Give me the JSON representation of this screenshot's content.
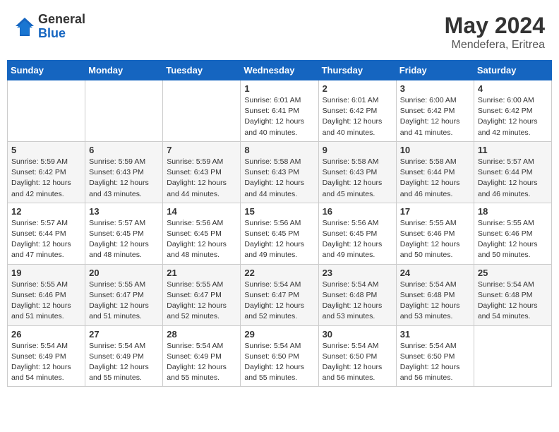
{
  "header": {
    "logo_general": "General",
    "logo_blue": "Blue",
    "month_year": "May 2024",
    "location": "Mendefera, Eritrea"
  },
  "weekdays": [
    "Sunday",
    "Monday",
    "Tuesday",
    "Wednesday",
    "Thursday",
    "Friday",
    "Saturday"
  ],
  "weeks": [
    [
      {
        "day": "",
        "sunrise": "",
        "sunset": "",
        "daylight": ""
      },
      {
        "day": "",
        "sunrise": "",
        "sunset": "",
        "daylight": ""
      },
      {
        "day": "",
        "sunrise": "",
        "sunset": "",
        "daylight": ""
      },
      {
        "day": "1",
        "sunrise": "Sunrise: 6:01 AM",
        "sunset": "Sunset: 6:41 PM",
        "daylight": "Daylight: 12 hours and 40 minutes."
      },
      {
        "day": "2",
        "sunrise": "Sunrise: 6:01 AM",
        "sunset": "Sunset: 6:42 PM",
        "daylight": "Daylight: 12 hours and 40 minutes."
      },
      {
        "day": "3",
        "sunrise": "Sunrise: 6:00 AM",
        "sunset": "Sunset: 6:42 PM",
        "daylight": "Daylight: 12 hours and 41 minutes."
      },
      {
        "day": "4",
        "sunrise": "Sunrise: 6:00 AM",
        "sunset": "Sunset: 6:42 PM",
        "daylight": "Daylight: 12 hours and 42 minutes."
      }
    ],
    [
      {
        "day": "5",
        "sunrise": "Sunrise: 5:59 AM",
        "sunset": "Sunset: 6:42 PM",
        "daylight": "Daylight: 12 hours and 42 minutes."
      },
      {
        "day": "6",
        "sunrise": "Sunrise: 5:59 AM",
        "sunset": "Sunset: 6:43 PM",
        "daylight": "Daylight: 12 hours and 43 minutes."
      },
      {
        "day": "7",
        "sunrise": "Sunrise: 5:59 AM",
        "sunset": "Sunset: 6:43 PM",
        "daylight": "Daylight: 12 hours and 44 minutes."
      },
      {
        "day": "8",
        "sunrise": "Sunrise: 5:58 AM",
        "sunset": "Sunset: 6:43 PM",
        "daylight": "Daylight: 12 hours and 44 minutes."
      },
      {
        "day": "9",
        "sunrise": "Sunrise: 5:58 AM",
        "sunset": "Sunset: 6:43 PM",
        "daylight": "Daylight: 12 hours and 45 minutes."
      },
      {
        "day": "10",
        "sunrise": "Sunrise: 5:58 AM",
        "sunset": "Sunset: 6:44 PM",
        "daylight": "Daylight: 12 hours and 46 minutes."
      },
      {
        "day": "11",
        "sunrise": "Sunrise: 5:57 AM",
        "sunset": "Sunset: 6:44 PM",
        "daylight": "Daylight: 12 hours and 46 minutes."
      }
    ],
    [
      {
        "day": "12",
        "sunrise": "Sunrise: 5:57 AM",
        "sunset": "Sunset: 6:44 PM",
        "daylight": "Daylight: 12 hours and 47 minutes."
      },
      {
        "day": "13",
        "sunrise": "Sunrise: 5:57 AM",
        "sunset": "Sunset: 6:45 PM",
        "daylight": "Daylight: 12 hours and 48 minutes."
      },
      {
        "day": "14",
        "sunrise": "Sunrise: 5:56 AM",
        "sunset": "Sunset: 6:45 PM",
        "daylight": "Daylight: 12 hours and 48 minutes."
      },
      {
        "day": "15",
        "sunrise": "Sunrise: 5:56 AM",
        "sunset": "Sunset: 6:45 PM",
        "daylight": "Daylight: 12 hours and 49 minutes."
      },
      {
        "day": "16",
        "sunrise": "Sunrise: 5:56 AM",
        "sunset": "Sunset: 6:45 PM",
        "daylight": "Daylight: 12 hours and 49 minutes."
      },
      {
        "day": "17",
        "sunrise": "Sunrise: 5:55 AM",
        "sunset": "Sunset: 6:46 PM",
        "daylight": "Daylight: 12 hours and 50 minutes."
      },
      {
        "day": "18",
        "sunrise": "Sunrise: 5:55 AM",
        "sunset": "Sunset: 6:46 PM",
        "daylight": "Daylight: 12 hours and 50 minutes."
      }
    ],
    [
      {
        "day": "19",
        "sunrise": "Sunrise: 5:55 AM",
        "sunset": "Sunset: 6:46 PM",
        "daylight": "Daylight: 12 hours and 51 minutes."
      },
      {
        "day": "20",
        "sunrise": "Sunrise: 5:55 AM",
        "sunset": "Sunset: 6:47 PM",
        "daylight": "Daylight: 12 hours and 51 minutes."
      },
      {
        "day": "21",
        "sunrise": "Sunrise: 5:55 AM",
        "sunset": "Sunset: 6:47 PM",
        "daylight": "Daylight: 12 hours and 52 minutes."
      },
      {
        "day": "22",
        "sunrise": "Sunrise: 5:54 AM",
        "sunset": "Sunset: 6:47 PM",
        "daylight": "Daylight: 12 hours and 52 minutes."
      },
      {
        "day": "23",
        "sunrise": "Sunrise: 5:54 AM",
        "sunset": "Sunset: 6:48 PM",
        "daylight": "Daylight: 12 hours and 53 minutes."
      },
      {
        "day": "24",
        "sunrise": "Sunrise: 5:54 AM",
        "sunset": "Sunset: 6:48 PM",
        "daylight": "Daylight: 12 hours and 53 minutes."
      },
      {
        "day": "25",
        "sunrise": "Sunrise: 5:54 AM",
        "sunset": "Sunset: 6:48 PM",
        "daylight": "Daylight: 12 hours and 54 minutes."
      }
    ],
    [
      {
        "day": "26",
        "sunrise": "Sunrise: 5:54 AM",
        "sunset": "Sunset: 6:49 PM",
        "daylight": "Daylight: 12 hours and 54 minutes."
      },
      {
        "day": "27",
        "sunrise": "Sunrise: 5:54 AM",
        "sunset": "Sunset: 6:49 PM",
        "daylight": "Daylight: 12 hours and 55 minutes."
      },
      {
        "day": "28",
        "sunrise": "Sunrise: 5:54 AM",
        "sunset": "Sunset: 6:49 PM",
        "daylight": "Daylight: 12 hours and 55 minutes."
      },
      {
        "day": "29",
        "sunrise": "Sunrise: 5:54 AM",
        "sunset": "Sunset: 6:50 PM",
        "daylight": "Daylight: 12 hours and 55 minutes."
      },
      {
        "day": "30",
        "sunrise": "Sunrise: 5:54 AM",
        "sunset": "Sunset: 6:50 PM",
        "daylight": "Daylight: 12 hours and 56 minutes."
      },
      {
        "day": "31",
        "sunrise": "Sunrise: 5:54 AM",
        "sunset": "Sunset: 6:50 PM",
        "daylight": "Daylight: 12 hours and 56 minutes."
      },
      {
        "day": "",
        "sunrise": "",
        "sunset": "",
        "daylight": ""
      }
    ]
  ]
}
